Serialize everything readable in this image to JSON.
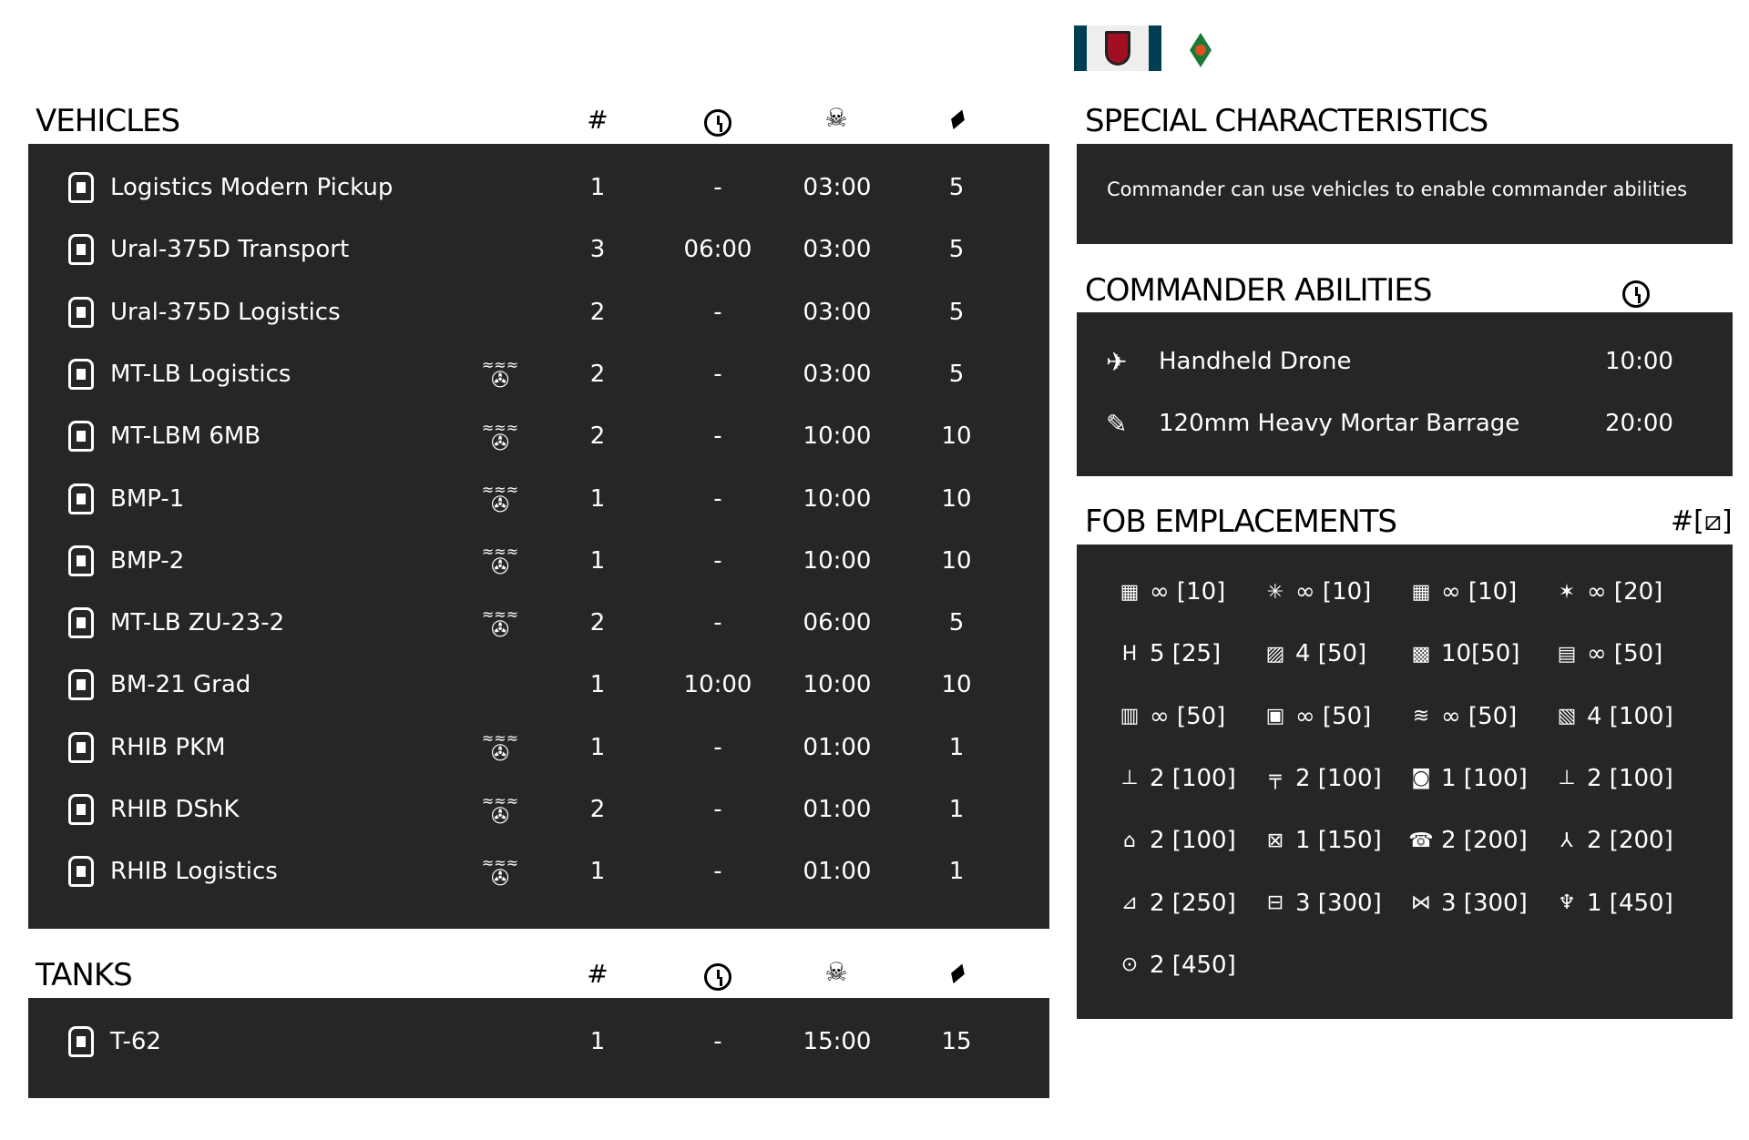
{
  "flags": [
    {
      "name": "faction-flag",
      "colors": [
        "#003f52",
        "#eeeeee",
        "#a01020"
      ]
    },
    {
      "name": "unit-emblem",
      "colors": [
        "#1a7a3a",
        "#d03020",
        "#f0b000"
      ]
    }
  ],
  "vehicles": {
    "title": "VEHICLES",
    "columns": {
      "count": "#",
      "respawn": "clock-icon",
      "kill": "skull-icon",
      "ticket": "ticket-icon"
    },
    "rows": [
      {
        "name": "Logistics Modern Pickup",
        "amphibious": false,
        "count": "1",
        "delay": "-",
        "respawn": "03:00",
        "tickets": "5"
      },
      {
        "name": "Ural-375D Transport",
        "amphibious": false,
        "count": "3",
        "delay": "06:00",
        "respawn": "03:00",
        "tickets": "5"
      },
      {
        "name": "Ural-375D Logistics",
        "amphibious": false,
        "count": "2",
        "delay": "-",
        "respawn": "03:00",
        "tickets": "5"
      },
      {
        "name": "MT-LB Logistics",
        "amphibious": true,
        "count": "2",
        "delay": "-",
        "respawn": "03:00",
        "tickets": "5"
      },
      {
        "name": "MT-LBM 6MB",
        "amphibious": true,
        "count": "2",
        "delay": "-",
        "respawn": "10:00",
        "tickets": "10"
      },
      {
        "name": "BMP-1",
        "amphibious": true,
        "count": "1",
        "delay": "-",
        "respawn": "10:00",
        "tickets": "10"
      },
      {
        "name": "BMP-2",
        "amphibious": true,
        "count": "1",
        "delay": "-",
        "respawn": "10:00",
        "tickets": "10"
      },
      {
        "name": "MT-LB ZU-23-2",
        "amphibious": true,
        "count": "2",
        "delay": "-",
        "respawn": "06:00",
        "tickets": "5"
      },
      {
        "name": "BM-21 Grad",
        "amphibious": false,
        "count": "1",
        "delay": "10:00",
        "respawn": "10:00",
        "tickets": "10"
      },
      {
        "name": "RHIB PKM",
        "amphibious": true,
        "count": "1",
        "delay": "-",
        "respawn": "01:00",
        "tickets": "1"
      },
      {
        "name": "RHIB DShK",
        "amphibious": true,
        "count": "2",
        "delay": "-",
        "respawn": "01:00",
        "tickets": "1"
      },
      {
        "name": "RHIB Logistics",
        "amphibious": true,
        "count": "1",
        "delay": "-",
        "respawn": "01:00",
        "tickets": "1"
      }
    ]
  },
  "tanks": {
    "title": "TANKS",
    "rows": [
      {
        "name": "T-62",
        "count": "1",
        "delay": "-",
        "respawn": "15:00",
        "tickets": "15"
      }
    ]
  },
  "special": {
    "title": "SPECIAL CHARACTERISTICS",
    "text": "Commander can use vehicles to enable commander abilities"
  },
  "commander": {
    "title": "COMMANDER ABILITIES",
    "rows": [
      {
        "icon": "drone-icon",
        "name": "Handheld Drone",
        "cooldown": "10:00"
      },
      {
        "icon": "mortar-strike-icon",
        "name": "120mm Heavy Mortar Barrage",
        "cooldown": "20:00"
      }
    ]
  },
  "fob": {
    "title": "FOB EMPLACEMENTS",
    "header": "#[",
    "items": [
      {
        "icon": "sandbag-icon",
        "text": "∞ [10]"
      },
      {
        "icon": "razorwire-icon",
        "text": "∞ [10]"
      },
      {
        "icon": "sandbag-icon",
        "text": "∞ [10]"
      },
      {
        "icon": "tank-trap-icon",
        "text": "∞ [20]"
      },
      {
        "icon": "ladder-icon",
        "text": "5 [25]"
      },
      {
        "icon": "camo-net-icon",
        "text": "4 [50]"
      },
      {
        "icon": "camo-net-large-icon",
        "text": "10[50]"
      },
      {
        "icon": "hesco-icon",
        "text": "∞ [50]"
      },
      {
        "icon": "sandbag-wall-icon",
        "text": "∞ [50]"
      },
      {
        "icon": "sandbag-wall-short-icon",
        "text": "∞ [50]"
      },
      {
        "icon": "log-wall-icon",
        "text": "∞ [50]"
      },
      {
        "icon": "camo-net-tall-icon",
        "text": "4 [100]"
      },
      {
        "icon": "hmg-icon",
        "text": "2 [100]"
      },
      {
        "icon": "mg-icon",
        "text": "2 [100]"
      },
      {
        "icon": "bunker-icon",
        "text": "1 [100]"
      },
      {
        "icon": "hmg-icon",
        "text": "2 [100]"
      },
      {
        "icon": "watchtower-icon",
        "text": "2 [100]"
      },
      {
        "icon": "ammo-crate-icon",
        "text": "1 [150]"
      },
      {
        "icon": "atgm-icon",
        "text": "2 [200]"
      },
      {
        "icon": "mortar-icon",
        "text": "2 [200]"
      },
      {
        "icon": "aa-gun-icon",
        "text": "2 [250]"
      },
      {
        "icon": "emplacement-icon",
        "text": "3 [300]"
      },
      {
        "icon": "tow-icon",
        "text": "3 [300]"
      },
      {
        "icon": "rocket-pod-icon",
        "text": "1 [450]"
      },
      {
        "icon": "field-gun-icon",
        "text": "2 [450]"
      }
    ]
  }
}
